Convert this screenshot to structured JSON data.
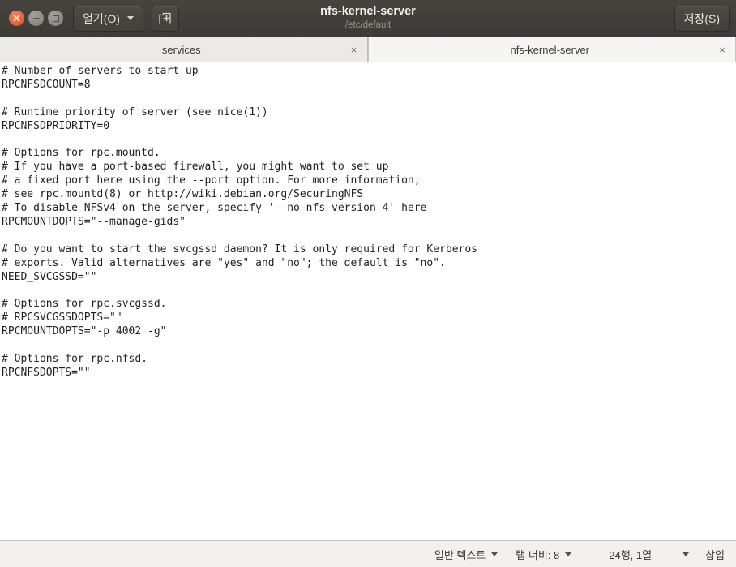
{
  "window": {
    "title": "nfs-kernel-server",
    "subtitle": "/etc/default",
    "controls": {
      "close": "×",
      "minimize": "−",
      "maximize": "□"
    }
  },
  "toolbar": {
    "open_label": "열기(O)",
    "new_tab_icon": "new-tab-icon",
    "save_label": "저장(S)"
  },
  "tabs": [
    {
      "label": "services",
      "close": "×",
      "active": false
    },
    {
      "label": "nfs-kernel-server",
      "close": "×",
      "active": true
    }
  ],
  "editor": {
    "content": "# Number of servers to start up\nRPCNFSDCOUNT=8\n\n# Runtime priority of server (see nice(1))\nRPCNFSDPRIORITY=0\n\n# Options for rpc.mountd.\n# If you have a port-based firewall, you might want to set up\n# a fixed port here using the --port option. For more information,\n# see rpc.mountd(8) or http://wiki.debian.org/SecuringNFS\n# To disable NFSv4 on the server, specify '--no-nfs-version 4' here\nRPCMOUNTDOPTS=\"--manage-gids\"\n\n# Do you want to start the svcgssd daemon? It is only required for Kerberos\n# exports. Valid alternatives are \"yes\" and \"no\"; the default is \"no\".\nNEED_SVCGSSD=\"\"\n\n# Options for rpc.svcgssd.\n# RPCSVCGSSDOPTS=\"\"\nRPCMOUNTDOPTS=\"-p 4002 -g\"\n\n# Options for rpc.nfsd.\nRPCNFSDOPTS=\"\""
  },
  "statusbar": {
    "language": "일반 텍스트",
    "tab_width": "탭 너비: 8",
    "cursor_position": "24행, 1열",
    "insert_mode": "삽입"
  },
  "colors": {
    "titlebar": "#403e3a",
    "accent_close": "#e8663a",
    "tab_active_bg": "#f6f5f4",
    "tab_inactive_bg": "#eceae7",
    "editor_bg": "#ffffff",
    "statusbar_bg": "#f2f1f0"
  }
}
